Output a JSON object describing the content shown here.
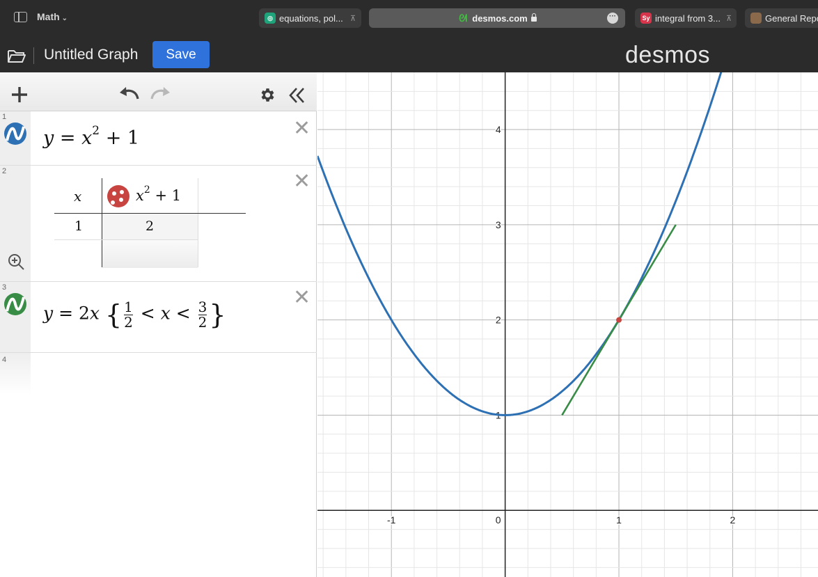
{
  "browser": {
    "tab_group": "Math",
    "tabs": [
      {
        "title": "equations, pol...",
        "favicon_color": "#1fa37a"
      },
      {
        "title": "desmos.com",
        "favicon_color": "#3fbf3f",
        "active": true
      },
      {
        "title": "integral from 3...",
        "favicon_color": "#d6354b",
        "favicon_text": "Sy"
      },
      {
        "title": "General Repo",
        "favicon_color": "#8a6a4a"
      }
    ]
  },
  "header": {
    "graph_title": "Untitled Graph",
    "save_label": "Save",
    "brand": "desmos"
  },
  "expressions": [
    {
      "index": "1",
      "latex": "y=x^2+1",
      "color": "#2d70b3"
    },
    {
      "index": "2",
      "type": "table",
      "col1_header": "x",
      "col2_header": "x^2+1",
      "color": "#c74440",
      "rows": [
        {
          "x": "1",
          "y": "2"
        }
      ]
    },
    {
      "index": "3",
      "latex": "y=2x {1/2 < x < 3/2}",
      "color": "#388c46"
    },
    {
      "index": "4"
    }
  ],
  "graph": {
    "x_tick_labels": [
      "-1",
      "0",
      "1",
      "2"
    ],
    "y_tick_labels": [
      "1",
      "2",
      "3",
      "4"
    ],
    "colors": {
      "curve": "#2d70b3",
      "tangent": "#388c46",
      "point": "#c74440"
    }
  },
  "chart_data": {
    "type": "line",
    "xlim": [
      -1.65,
      2.75
    ],
    "ylim": [
      -0.7,
      4.6
    ],
    "series": [
      {
        "expression": "y = x^2 + 1",
        "color": "#2d70b3"
      },
      {
        "expression": "y = 2x, 1/2 < x < 3/2",
        "x": [
          0.5,
          1.5
        ],
        "y": [
          1,
          3
        ],
        "color": "#388c46"
      }
    ],
    "points": [
      {
        "x": 1,
        "y": 2,
        "color": "#c74440"
      }
    ],
    "grid": true
  }
}
